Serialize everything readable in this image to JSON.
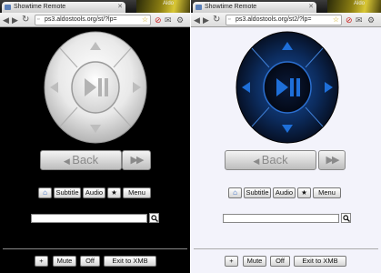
{
  "left_window": {
    "tab_title": "Showtime Remote",
    "url": "ps3.aldostools.org/st/?lp=",
    "deco_text": "Aldo",
    "back_label": "Back",
    "ffw_label": "▶▶",
    "home_label": "⌂",
    "subtitle_label": "Subtitle",
    "audio_label": "Audio",
    "star_label": "★",
    "menu_label": "Menu",
    "search_value": "",
    "volume_label": "+",
    "mute_label": "Mute",
    "off_label": "Off",
    "exit_label": "Exit to XMB",
    "pad_style": "silver on black"
  },
  "right_window": {
    "tab_title": "Showtime Remote",
    "url": "ps3.aldostools.org/st2/?lp=",
    "deco_text": "Aldo",
    "back_label": "Back",
    "ffw_label": "▶▶",
    "home_label": "⌂",
    "subtitle_label": "Subtitle",
    "audio_label": "Audio",
    "star_label": "★",
    "menu_label": "Menu",
    "search_value": "",
    "volume_label": "+",
    "mute_label": "Mute",
    "off_label": "Off",
    "exit_label": "Exit to XMB",
    "pad_style": "black with blue glow"
  },
  "colors": {
    "left_bg": "#000000",
    "right_bg": "#f3f3fb",
    "pad_blue": "#1e6fd9",
    "home_icon": "#2a63c4"
  }
}
